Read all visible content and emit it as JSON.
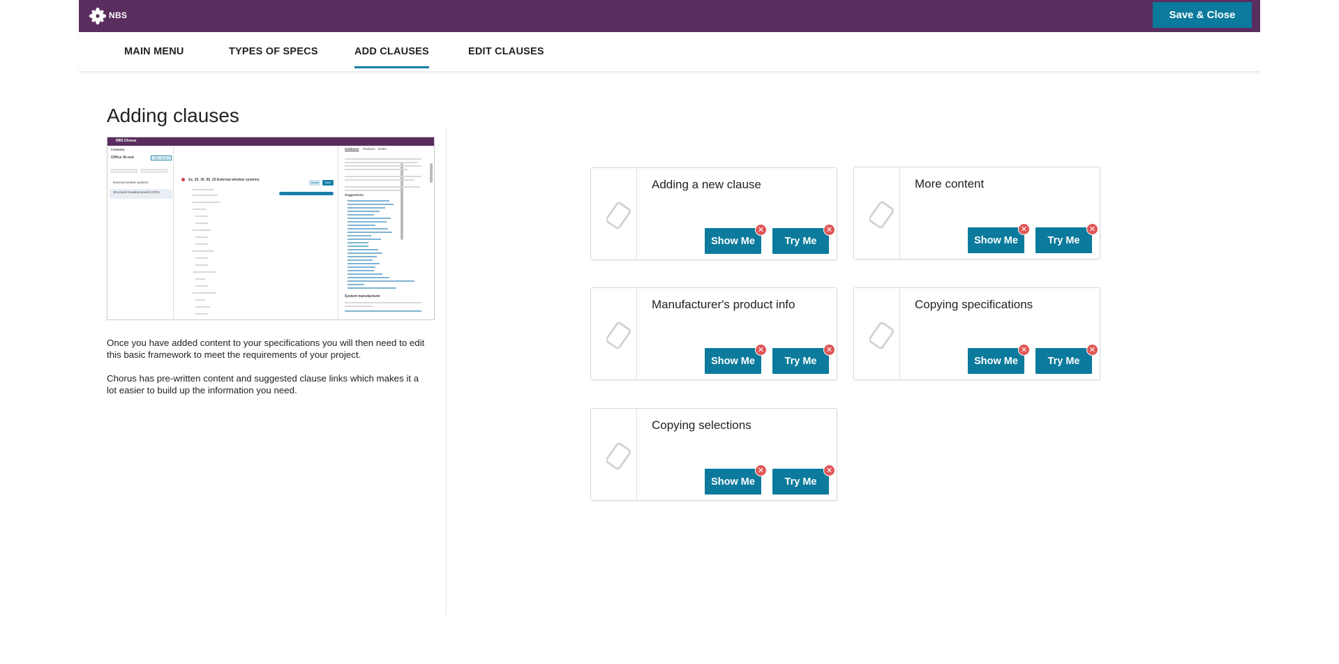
{
  "header": {
    "logo_text": "NBS",
    "save_close_label": "Save & Close"
  },
  "tabs": [
    {
      "label": "MAIN MENU",
      "active": false
    },
    {
      "label": "TYPES OF SPECS",
      "active": false
    },
    {
      "label": "ADD CLAUSES",
      "active": true
    },
    {
      "label": "EDIT CLAUSES",
      "active": false
    }
  ],
  "main": {
    "title": "Adding clauses",
    "paragraphs": [
      "Once you have added content to your specifications you will then need to edit this basic framework to meet the requirements of your project.",
      "Chorus has pre-written content and suggested clause links which makes it a lot easier to build up the information you need."
    ],
    "screenshot": {
      "app_name": "NBS Chorus",
      "contents_label": "Contents",
      "project_label": "Office fit-out",
      "add_content_label": "Add content",
      "clause_title": "Ss_25_30_95_25 External window systems",
      "guidance_tab": "Guidance",
      "products_tab": "Products",
      "notes_tab": "Notes",
      "suggestions_label": "Suggestions",
      "system_manufacturer_label": "System manufacturer",
      "left_items": [
        "External window systems",
        "Structural insulated panels (SIPs)"
      ],
      "discard_label": "Discard",
      "save_label": "Save"
    }
  },
  "cards": [
    {
      "title": "Adding a new clause",
      "show_label": "Show Me",
      "try_label": "Try Me"
    },
    {
      "title": "More content",
      "show_label": "Show Me",
      "try_label": "Try Me"
    },
    {
      "title": "Manufacturer's product info",
      "show_label": "Show Me",
      "try_label": "Try Me"
    },
    {
      "title": "Copying specifications",
      "show_label": "Show Me",
      "try_label": "Try Me"
    },
    {
      "title": "Copying selections",
      "show_label": "Show Me",
      "try_label": "Try Me"
    }
  ],
  "icons": {
    "logo": "nbs-logo-icon",
    "thumb": "eraser-placeholder-icon",
    "badge": "close-icon",
    "badge_glyph": "✕"
  },
  "colors": {
    "header_bg": "#5a2d5f",
    "primary_button": "#0b7a9c",
    "active_tab_underline": "#1a7fa8",
    "close_badge": "#e05656"
  }
}
